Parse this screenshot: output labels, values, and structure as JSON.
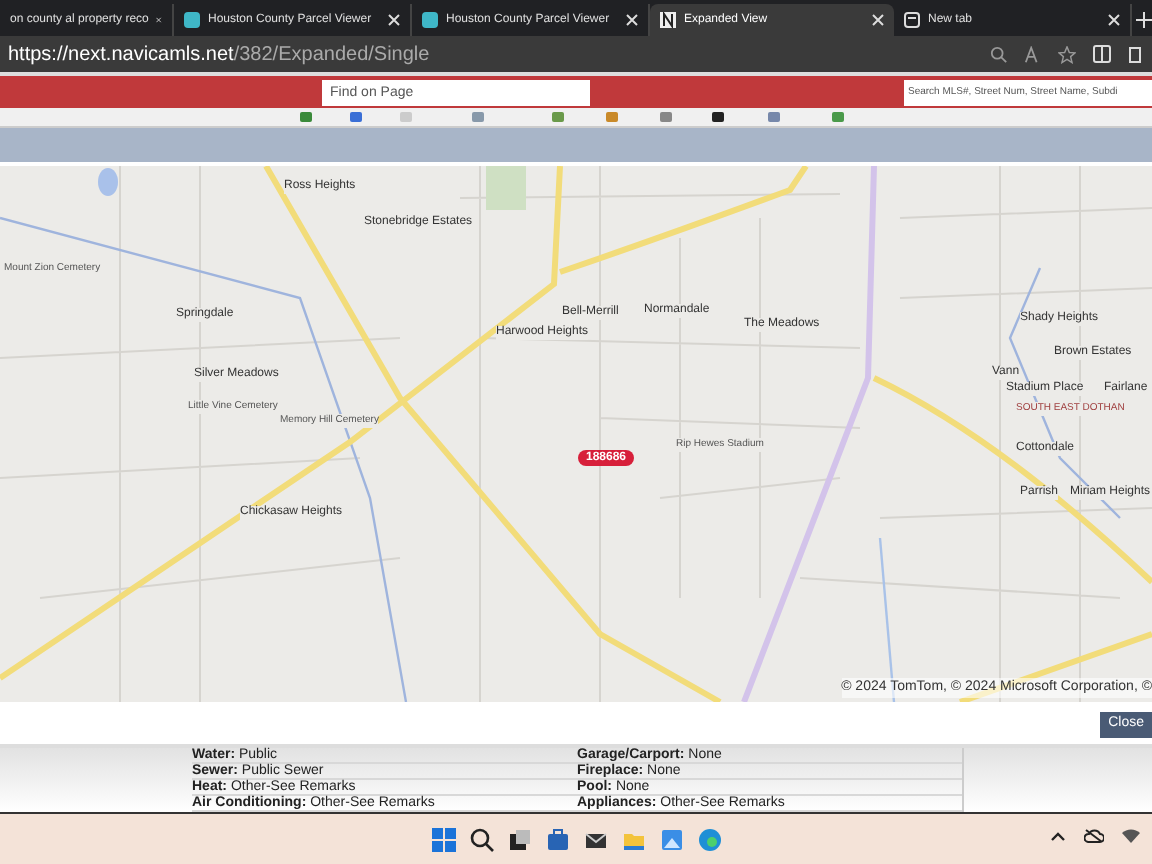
{
  "tabs": [
    {
      "title": "on county al property reco",
      "selected": false
    },
    {
      "title": "Houston County Parcel Viewer",
      "selected": false
    },
    {
      "title": "Houston County Parcel Viewer",
      "selected": false
    },
    {
      "title": "Expanded View",
      "selected": true
    },
    {
      "title": "New tab",
      "selected": false
    }
  ],
  "address": {
    "host": "https://next.navicamls.net",
    "path": "/382/Expanded/Single"
  },
  "find_field": {
    "placeholder": "Find on Page"
  },
  "search_field": {
    "placeholder": "Search MLS#, Street Num, Street Name, Subdi"
  },
  "map": {
    "places": [
      "Ross Heights",
      "Stonebridge Estates",
      "Mount Zion Cemetery",
      "Springdale",
      "Silver Meadows",
      "Bell-Merrill",
      "Harwood Heights",
      "Normandale",
      "The Meadows",
      "Shady Heights",
      "Brown Estates",
      "Vann",
      "Stadium Place",
      "Fairlane",
      "SOUTH EAST DOTHAN",
      "Cottondale",
      "Parrish",
      "Miriam Heights",
      "Chickasaw Heights",
      "Memory Hill Cemetery",
      "Little Vine Cemetery",
      "Rip Hewes Stadium"
    ],
    "pin": "188686",
    "copyright": "© 2024 TomTom, © 2024 Microsoft Corporation, ©"
  },
  "close_button": "Close",
  "details": [
    {
      "label": "Water:",
      "value": "Public"
    },
    {
      "label": "Garage/Carport:",
      "value": "None"
    },
    {
      "label": "Sewer:",
      "value": "Public Sewer"
    },
    {
      "label": "Fireplace:",
      "value": "None"
    },
    {
      "label": "Heat:",
      "value": "Other-See Remarks"
    },
    {
      "label": "Pool:",
      "value": "None"
    },
    {
      "label": "Air Conditioning:",
      "value": "Other-See Remarks"
    },
    {
      "label": "Appliances:",
      "value": "Other-See Remarks"
    }
  ]
}
